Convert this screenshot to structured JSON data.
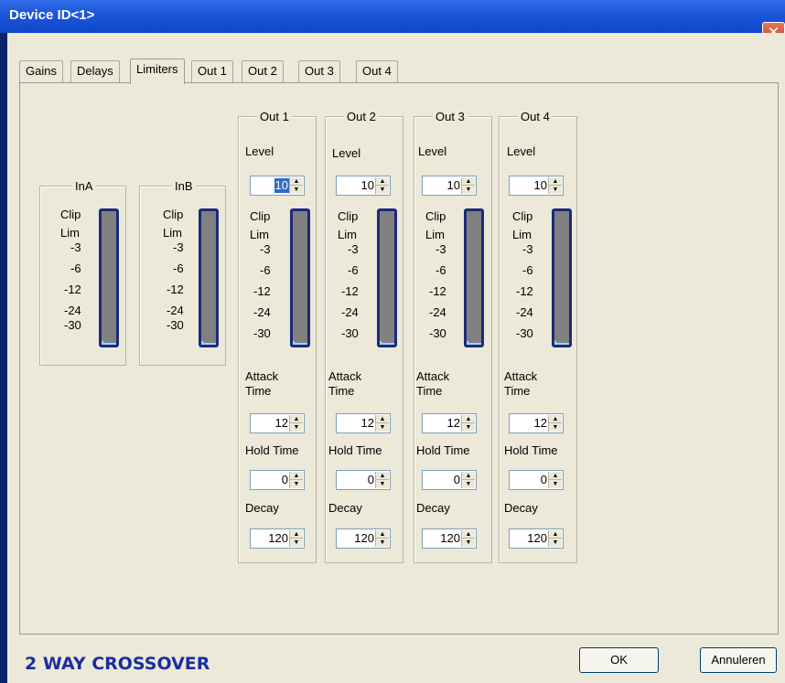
{
  "window": {
    "title": "Device ID<1>",
    "close_glyph": "✕"
  },
  "tabs": [
    {
      "label": "Gains"
    },
    {
      "label": "Delays"
    },
    {
      "label": "Limiters",
      "active": true
    },
    {
      "label": "Out 1"
    },
    {
      "label": "Out 2"
    },
    {
      "label": "Out 3"
    },
    {
      "label": "Out 4"
    }
  ],
  "meter_scale": [
    "Clip",
    "Lim",
    "-3",
    "-6",
    "-12",
    "-24",
    "-30"
  ],
  "inputs": [
    {
      "name": "InA"
    },
    {
      "name": "InB"
    }
  ],
  "labels": {
    "level": "Level",
    "attack_line1": "Attack",
    "attack_line2": "Time",
    "hold": "Hold Time",
    "decay": "Decay"
  },
  "outputs": [
    {
      "name": "Out 1",
      "level": "10",
      "attack": "12",
      "hold": "0",
      "decay": "120"
    },
    {
      "name": "Out 2",
      "level": "10",
      "attack": "12",
      "hold": "0",
      "decay": "120"
    },
    {
      "name": "Out 3",
      "level": "10",
      "attack": "12",
      "hold": "0",
      "decay": "120"
    },
    {
      "name": "Out 4",
      "level": "10",
      "attack": "12",
      "hold": "0",
      "decay": "120"
    }
  ],
  "footer": {
    "brand": "2 WAY CROSSOVER",
    "ok_label": "OK",
    "cancel_label": "Annuleren"
  },
  "colors": {
    "title_bar": "#1d58db",
    "meter_frame": "#1c2a7a",
    "meter_body": "#808080",
    "brand_text": "#1b2e9c"
  }
}
